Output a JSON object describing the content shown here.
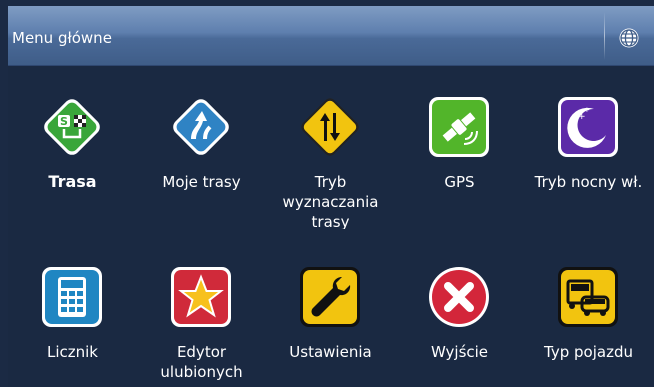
{
  "header": {
    "title": "Menu główne",
    "globe_icon": "globe-icon"
  },
  "menu": {
    "row1": [
      {
        "label": "Trasa",
        "icon": "route-sign-icon",
        "color": "#3aa63a"
      },
      {
        "label": "Moje trasy",
        "icon": "my-routes-icon",
        "color": "#2f83c4"
      },
      {
        "label": "Tryb wyznaczania trasy",
        "icon": "route-mode-sign-icon",
        "color": "#f2c40f"
      },
      {
        "label": "GPS",
        "icon": "satellite-icon",
        "color": "#52b52a"
      },
      {
        "label": "Tryb nocny wł.",
        "icon": "moon-icon",
        "color": "#5b2aa8"
      }
    ],
    "row2": [
      {
        "label": "Licznik",
        "icon": "calculator-icon",
        "color": "#1f86c2"
      },
      {
        "label": "Edytor ulubionych",
        "icon": "star-icon",
        "color": "#d02a3a"
      },
      {
        "label": "Ustawienia",
        "icon": "wrench-icon",
        "color": "#f2c40f"
      },
      {
        "label": "Wyjście",
        "icon": "exit-icon",
        "color": "#d3263a"
      },
      {
        "label": "Typ pojazdu",
        "icon": "vehicle-type-icon",
        "color": "#f2c40f"
      }
    ]
  }
}
